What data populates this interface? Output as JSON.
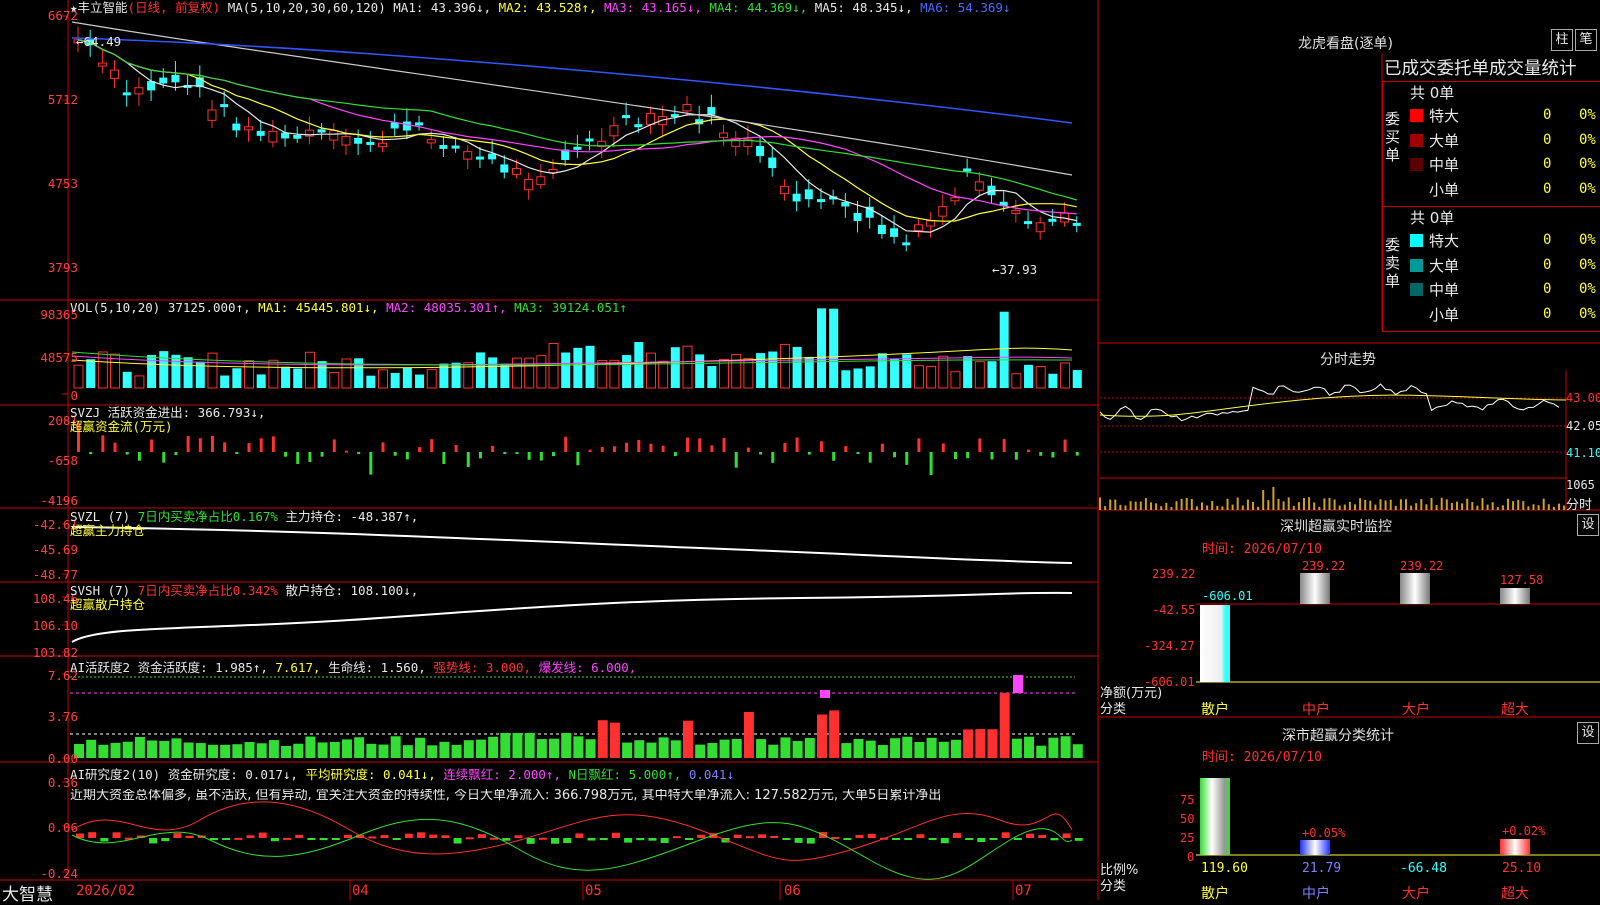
{
  "left_axis": {
    "price": [
      "6672",
      "5712",
      "4753",
      "3793"
    ],
    "vol": [
      "98365",
      "48575",
      "0"
    ],
    "svzj": [
      "2081",
      "-658",
      "-4196"
    ],
    "svzl": [
      "-42.61",
      "-45.69",
      "-48.77"
    ],
    "svsh": [
      "108.46",
      "106.10",
      "103.82"
    ],
    "ai1": [
      "7.62",
      "3.76",
      "0.00"
    ],
    "ai2": [
      "0.36",
      "0.06",
      "-0.24"
    ]
  },
  "price_legend": {
    "star": "★",
    "name": "丰立智能",
    "mode": "(日线, 前复权)",
    "ma_def": "MA(5,10,20,30,60,120)",
    "ma1": "MA1: 43.396↓,",
    "ma2": "MA2: 43.528↑,",
    "ma3": "MA3: 43.165↓,",
    "ma4": "MA4: 44.369↓,",
    "ma5": "MA5: 48.345↓,",
    "ma6": "MA6: 54.369↓"
  },
  "price_notes": {
    "high": "←64.49",
    "low": "←37.93"
  },
  "vol_legend": {
    "def": "VOL(5,10,20)",
    "val": "37125.000↑,",
    "ma1": "MA1: 45445.801↓,",
    "ma2": "MA2: 48035.301↑,",
    "ma3": "MA3: 39124.051↑"
  },
  "svzj_legend": {
    "line1": "SVZJ  活跃资金进出: 366.793↓,",
    "line2": "超赢资金流(万元)"
  },
  "svzl_legend": {
    "def": "SVZL (7)",
    "ratio": "7日内买卖净占比0.167%",
    "val": "主力持仓: -48.387↑,",
    "line2": "超赢主力持仓"
  },
  "svsh_legend": {
    "def": "SVSH (7)",
    "ratio": "7日内买卖净占比0.342%",
    "val": "散户持仓: 108.100↓,",
    "line2": "超赢散户持仓"
  },
  "ai1_legend": {
    "def": "AI活跃度2",
    "a": "资金活跃度: 1.985↑,",
    "b": "7.617,",
    "c": "生命线: 1.560,",
    "d": "强势线: 3.000,",
    "e": "爆发线: 6.000,"
  },
  "ai2_legend": {
    "def": "AI研究度2(10)",
    "a": "资金研究度: 0.017↓,",
    "b": "平均研究度: 0.041↓,",
    "c": "连续飘红: 2.000↑,",
    "d": "N日飘红: 5.000↑,",
    "e": "0.041↓"
  },
  "ai2_comment": "近期大资金总体偏多, 虽不活跃, 但有异动, 宜关注大资金的持续性, 今日大单净流入: 366.798万元, 其中特大单净流入: 127.582万元, 大单5日累计净出",
  "xaxis": {
    "brand": "大智慧",
    "labels": [
      "2026/02",
      "04",
      "05",
      "06",
      "07"
    ]
  },
  "lhb": {
    "title": "龙虎看盘(逐单)",
    "btn1": "柱",
    "btn2": "笔",
    "header": "已成交委托单成交量统计",
    "buy_side": "委买单",
    "sell_side": "委卖单",
    "buy_total": "共 0单",
    "sell_total": "共 0单",
    "buy_rows": [
      {
        "label": "特大",
        "count": "0",
        "pct": "0%",
        "color": "#ff0000"
      },
      {
        "label": "大单",
        "count": "0",
        "pct": "0%",
        "color": "#a00000"
      },
      {
        "label": "中单",
        "count": "0",
        "pct": "0%",
        "color": "#5a0000"
      },
      {
        "label": "小单",
        "count": "0",
        "pct": "0%",
        "color": "#000000"
      }
    ],
    "sell_rows": [
      {
        "label": "特大",
        "count": "0",
        "pct": "0%",
        "color": "#00ffff"
      },
      {
        "label": "大单",
        "count": "0",
        "pct": "0%",
        "color": "#009999"
      },
      {
        "label": "中单",
        "count": "0",
        "pct": "0%",
        "color": "#006666"
      },
      {
        "label": "小单",
        "count": "0",
        "pct": "0%",
        "color": "#000000"
      }
    ]
  },
  "intraday": {
    "title": "分时走势",
    "p1": "43.00",
    "p2": "42.05",
    "p3": "41.10",
    "vol": "1065",
    "unit": "分时"
  },
  "monitor": {
    "title": "深圳超赢实时监控",
    "btn": "设",
    "time": "时间: 2026/07/10",
    "axis": [
      "239.22",
      "-42.55",
      "-324.27",
      "-606.01"
    ],
    "bar_labels": [
      "-606.01",
      "239.22",
      "239.22",
      "127.58"
    ],
    "ylabel1": "净额(万元)",
    "ylabel2": "分类",
    "cats": [
      "散户",
      "中户",
      "大户",
      "超大"
    ]
  },
  "classify": {
    "title": "深市超赢分类统计",
    "btn": "设",
    "time": "时间: 2026/07/10",
    "axis": [
      "75",
      "50",
      "25",
      "0"
    ],
    "pct_labels": [
      "+0.05%",
      "+0.02%"
    ],
    "values": [
      "119.60",
      "21.79",
      "-66.48",
      "25.10"
    ],
    "ylabel1": "比例%",
    "ylabel2": "分类",
    "cats": [
      "散户",
      "中户",
      "大户",
      "超大"
    ]
  },
  "colors": {
    "up": "#ff3030",
    "down": "#33ffff",
    "grid": "#c00000",
    "mid_green": "#33dd33"
  }
}
